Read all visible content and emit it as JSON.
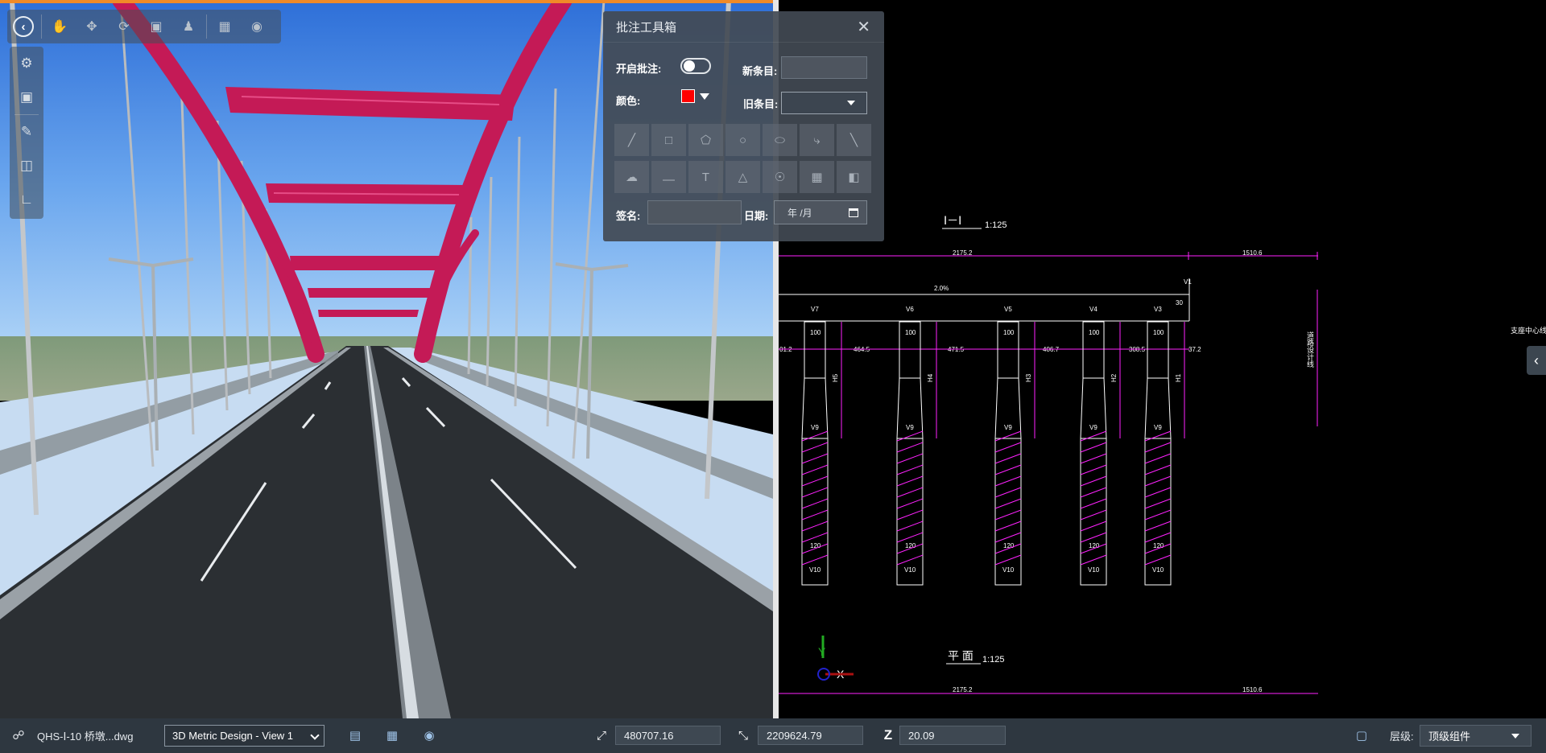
{
  "file": {
    "name": "QHS-Ⅰ-10 桥墩...dwg",
    "icon": "file-icon"
  },
  "view": {
    "selected": "3D Metric Design - View 1"
  },
  "coords": {
    "x": "480707.16",
    "y": "2209624.79",
    "z": "20.09"
  },
  "level": {
    "label": "层级:",
    "selected": "顶级组件"
  },
  "annotation_panel": {
    "title": "批注工具箱",
    "enable_label": "开启批注:",
    "new_item_label": "新条目:",
    "color_label": "颜色:",
    "old_item_label": "旧条目:",
    "signature_label": "签名:",
    "date_label": "日期:",
    "date_placeholder": "年 /月",
    "color_value": "#ff0000"
  },
  "cad": {
    "section_title": "Ⅰ－Ⅰ",
    "section_scale": "1:125",
    "plan_title": "平 面",
    "plan_scale": "1:125",
    "dim_left": "2175.2",
    "dim_right": "1510.6",
    "slope": "2.0%",
    "pier_labels": [
      "V7",
      "V6",
      "V5",
      "V4",
      "V3"
    ],
    "top_label": "V1",
    "top_dim": "30",
    "pier_dims": [
      "100",
      "100",
      "100",
      "100",
      "100"
    ],
    "spacing_dims": [
      "01.2",
      "464.5",
      "471.5",
      "406.7",
      "308.5",
      "37.2"
    ],
    "height_labels": [
      "H5",
      "H4",
      "H3",
      "H2",
      "H1"
    ],
    "mid_labels": [
      "V9",
      "V9",
      "V9",
      "V9",
      "V9"
    ],
    "lower_dims": [
      "120",
      "120",
      "120",
      "120",
      "120"
    ],
    "bottom_labels": [
      "V10",
      "V10",
      "V10",
      "V10",
      "V10"
    ],
    "vertical_note": "道路设计线",
    "support_note": "支座中心线",
    "axis_y": "Y",
    "axis_x": "X"
  }
}
